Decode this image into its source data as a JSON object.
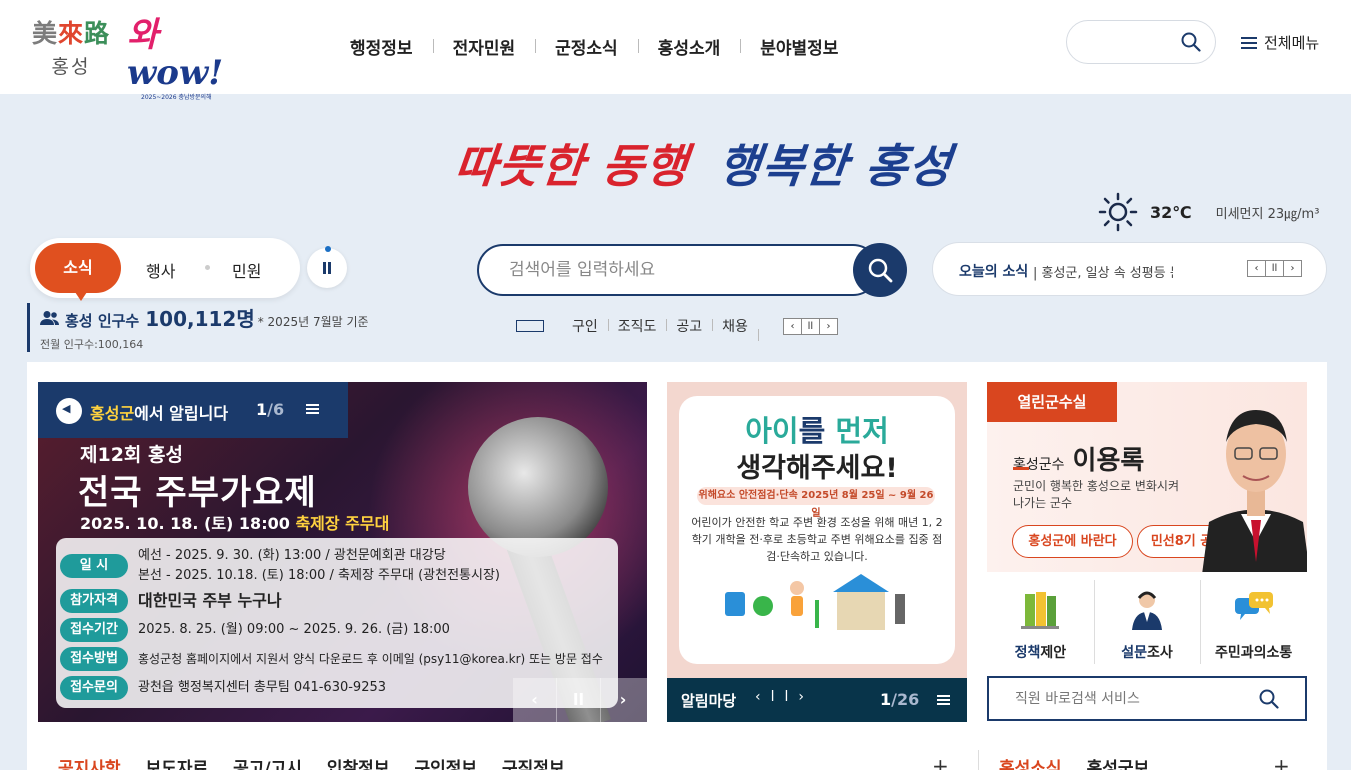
{
  "header": {
    "logo_line1_a": "美",
    "logo_line1_b": "來",
    "logo_line1_c": "路",
    "logo_line2": "홍성",
    "wow_text": "와",
    "wow_text2": "wow!",
    "wow_sub": "2025~2026 충남방문의해",
    "nav": [
      "행정정보",
      "전자민원",
      "군정소식",
      "홍성소개",
      "분야별정보"
    ],
    "all_menu_label": "전체메뉴"
  },
  "slogan": {
    "red_part": "따뜻한 동행",
    "blue_part": "행복한 홍성"
  },
  "weather": {
    "temperature": "32℃",
    "fine_dust": "미세먼지 23㎍/m³"
  },
  "tabs": {
    "active": "소식",
    "second": "행사",
    "third": "민원"
  },
  "population": {
    "label": "홍성 인구수",
    "value": "100,112명",
    "basis": "* 2025년 7월말 기준",
    "prev_month": "전월 인구수:100,164"
  },
  "search": {
    "placeholder": "검색어를 입력하세요"
  },
  "keywords": [
    "구인",
    "조직도",
    "공고",
    "채용"
  ],
  "today": {
    "label": "오늘의 소식",
    "text": "| 홍성군, 일상 속 성평등 문..."
  },
  "banner": {
    "head_highlight": "홍성군",
    "head_rest": "에서 알립니다",
    "count_current": "1",
    "count_total": "/6",
    "line1": "제12회 홍성",
    "line2": "전국 주부가요제",
    "line3_a": "2025. 10. 18. (토) 18:00 ",
    "line3_b": "축제장 주무대",
    "rows": [
      {
        "tag": "일  시",
        "val": "예선 - 2025. 9. 30. (화) 13:00 / 광천문예회관 대강당",
        "val2": "본선 - 2025. 10.18. (토) 18:00 / 축제장 주무대 (광천전통시장)"
      },
      {
        "tag": "참가자격",
        "val": "대한민국 주부 누구나"
      },
      {
        "tag": "접수기간",
        "val": "2025. 8. 25. (월) 09:00 ~ 2025. 9. 26. (금) 18:00"
      },
      {
        "tag": "접수방법",
        "val": "홍성군청 홈페이지에서 지원서 양식 다운로드 후 이메일 (psy11@korea.kr) 또는 방문 접수"
      },
      {
        "tag": "접수문의",
        "val": "광천읍 행정복지센터 총무팀 041-630-9253"
      }
    ]
  },
  "notice": {
    "h1_a": "아이",
    "h1_b": "를 ",
    "h1_c": "먼저",
    "h2": "생각해주세요!",
    "pill": "위해요소 안전점검·단속   2025년 8월 25일 ~ 9월 26일",
    "desc": "어린이가 안전한 학교 주변 환경 조성을 위해 매년 1, 2학기 개학을 전·후로 초등학교 주변 위해요소를 집중 점검·단속하고 있습니다.",
    "footer_label": "알림마당",
    "count_current": "1",
    "count_total": "/26"
  },
  "mayor": {
    "badge": "열린군수실",
    "title": "홍성군수",
    "name": "이용록",
    "desc": "군민이 행복한 홍성으로 변화시켜나가는 군수",
    "btn1": "홍성군에 바란다",
    "btn2": "민선8기 공약"
  },
  "quick": [
    {
      "bold": "정책",
      "rest": "제안"
    },
    {
      "bold": "설문",
      "rest": "조사"
    },
    {
      "bold": "",
      "rest": "주민과의소통"
    }
  ],
  "staff_search": {
    "placeholder": "직원 바로검색 서비스"
  },
  "bottom_tabs": [
    "공지사항",
    "보도자료",
    "공고/고시",
    "입찰정보",
    "구인정보",
    "구직정보"
  ],
  "bottom_tabs2": [
    "홍성소식",
    "홍성군보"
  ]
}
